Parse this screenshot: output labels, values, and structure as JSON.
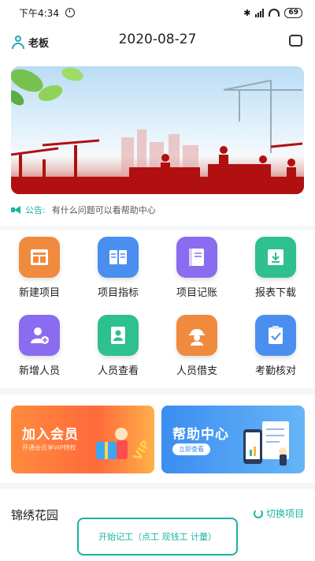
{
  "status_bar": {
    "time": "下午4:34",
    "battery": "69"
  },
  "header": {
    "user_label": "老板",
    "date": "2020-08-27"
  },
  "notice": {
    "label": "公告:",
    "text": "有什么问题可以看帮助中心"
  },
  "grid": [
    {
      "label": "新建项目",
      "icon": "new-project-icon",
      "color": "#f08a3e"
    },
    {
      "label": "项目指标",
      "icon": "project-metrics-icon",
      "color": "#4a8ff0"
    },
    {
      "label": "项目记账",
      "icon": "project-ledger-icon",
      "color": "#8a6cf0"
    },
    {
      "label": "报表下载",
      "icon": "report-download-icon",
      "color": "#2ec08d"
    },
    {
      "label": "新增人员",
      "icon": "add-person-icon",
      "color": "#8a6cf0"
    },
    {
      "label": "人员查看",
      "icon": "view-personnel-icon",
      "color": "#2ec08d"
    },
    {
      "label": "人员借支",
      "icon": "personnel-advance-icon",
      "color": "#f08a3e"
    },
    {
      "label": "考勤核对",
      "icon": "attendance-check-icon",
      "color": "#4a8ff0"
    }
  ],
  "promos": {
    "member": {
      "title": "加入会员",
      "sub": "开通会员享VIP特权",
      "badge": "VIP"
    },
    "help": {
      "title": "帮助中心",
      "pill": "立即查看"
    }
  },
  "project": {
    "name": "锦绣花园",
    "switch_label": "切换项目"
  },
  "start_button": {
    "label": "开始记工（点工 现钱工 计量）"
  }
}
